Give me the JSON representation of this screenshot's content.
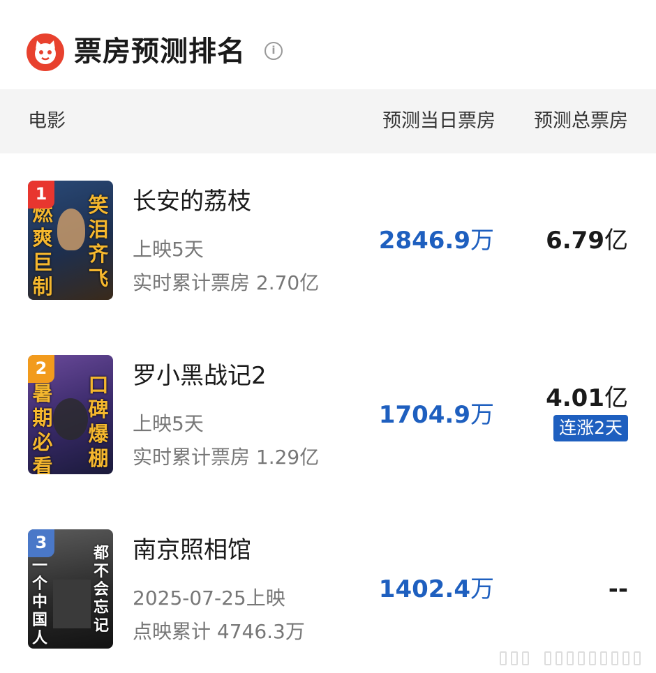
{
  "header": {
    "title": "票房预测排名",
    "info_symbol": "i",
    "logo_icon": "cat-logo-icon"
  },
  "columns": {
    "movie": "电影",
    "day": "预测当日票房",
    "total": "预测总票房"
  },
  "colors": {
    "accent_blue": "#1e5fbf",
    "logo_red": "#e8412e"
  },
  "movies": [
    {
      "rank": "1",
      "rank_color": "#e8362f",
      "name": "长安的荔枝",
      "line1": "上映5天",
      "line2": "实时累计票房 2.70亿",
      "day_value": "2846.9",
      "day_unit": "万",
      "total_value": "6.79",
      "total_unit": "亿",
      "trend": "",
      "poster_left": "燃爽巨制",
      "poster_right": "笑泪齐飞"
    },
    {
      "rank": "2",
      "rank_color": "#f29b1d",
      "name": "罗小黑战记2",
      "line1": "上映5天",
      "line2": "实时累计票房 1.29亿",
      "day_value": "1704.9",
      "day_unit": "万",
      "total_value": "4.01",
      "total_unit": "亿",
      "trend": "连涨2天",
      "poster_left": "暑期必看",
      "poster_right": "口碑爆棚"
    },
    {
      "rank": "3",
      "rank_color": "#4a78c8",
      "name": "南京照相馆",
      "line1": "2025-07-25上映",
      "line2": "点映累计 4746.3万",
      "day_value": "1402.4",
      "day_unit": "万",
      "total_value": "--",
      "total_unit": "",
      "trend": "",
      "poster_left": "一个中国人",
      "poster_right": "都不会忘记"
    }
  ]
}
